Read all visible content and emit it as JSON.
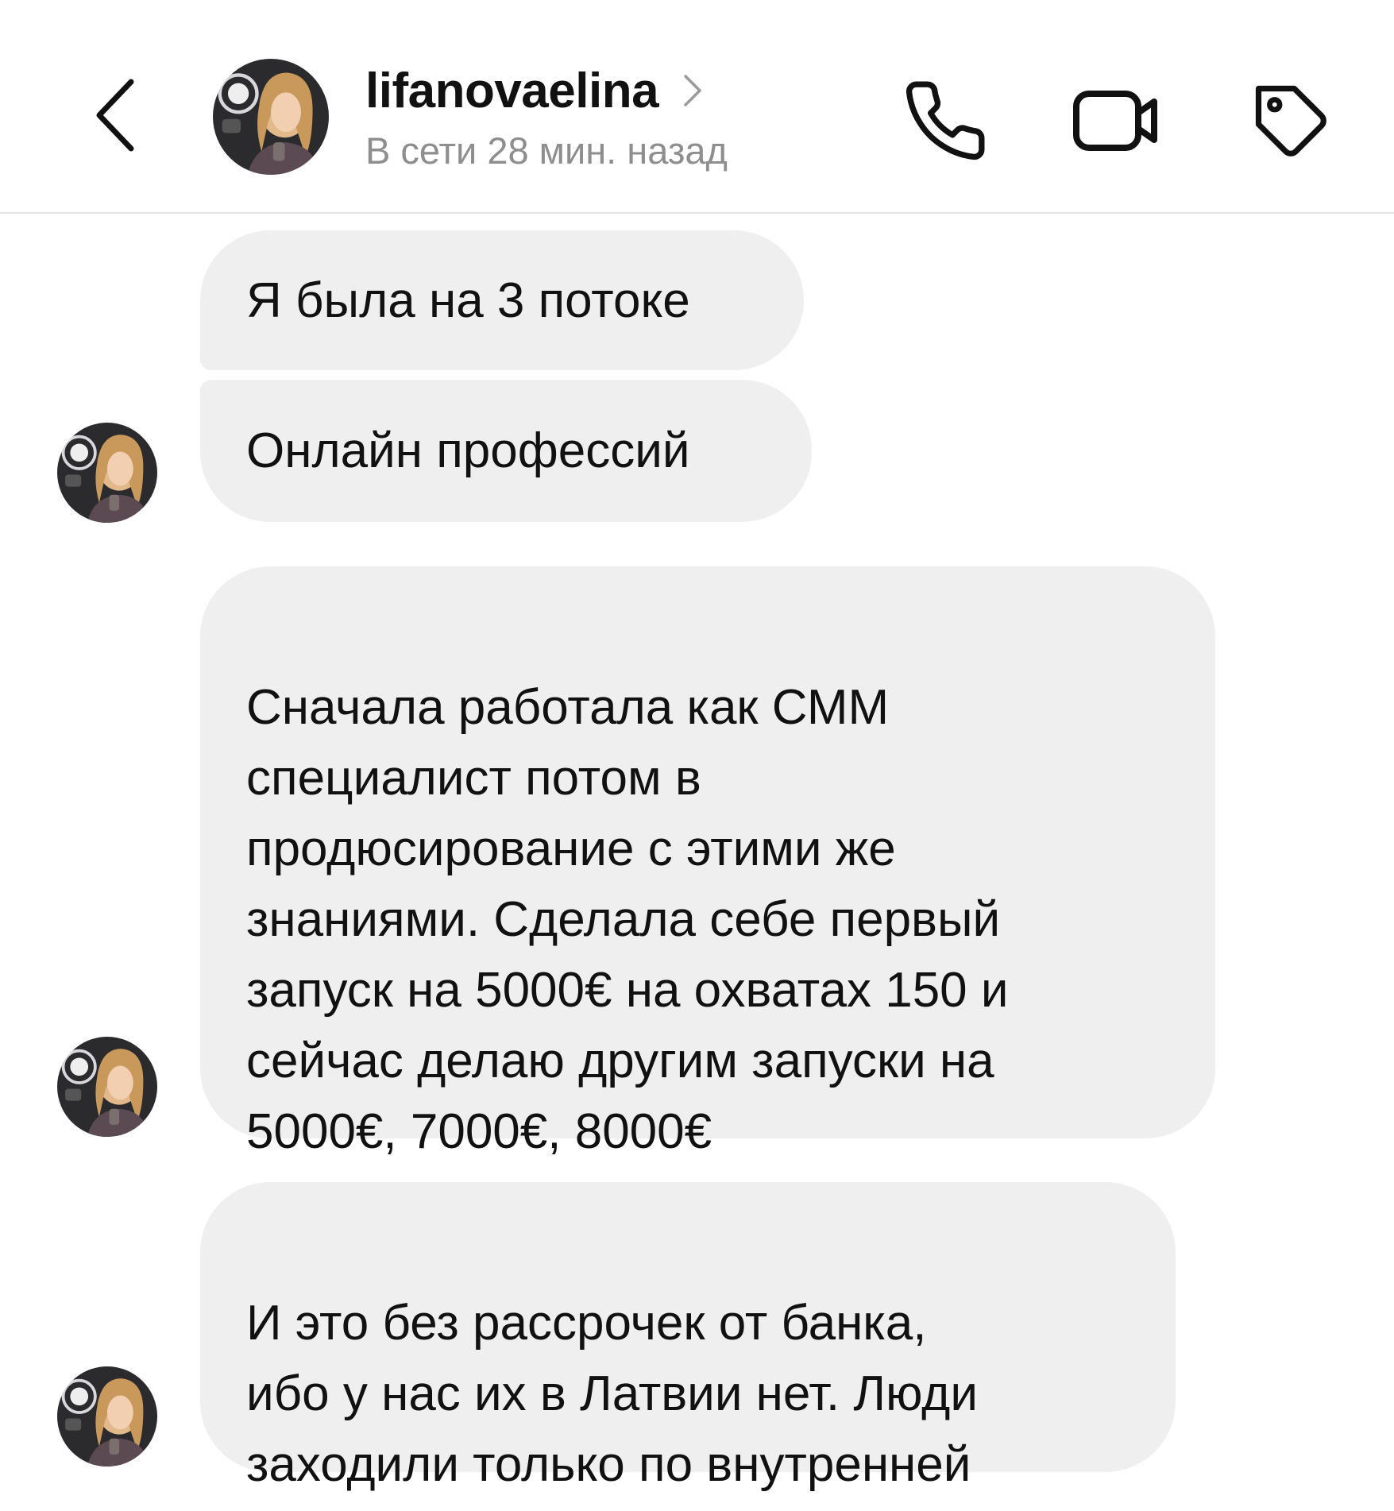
{
  "header": {
    "username": "lifanovaelina",
    "status": "В сети 28 мин. назад",
    "icons": {
      "back": "chevron-left-icon",
      "profile": "chevron-right-icon",
      "call": "phone-icon",
      "video": "video-camera-icon",
      "tag": "tag-icon"
    }
  },
  "messages": [
    {
      "text": "Я была на 3 потоке"
    },
    {
      "text": "Онлайн профессий"
    },
    {
      "text": "Сначала работала как СММ\nспециалист потом в\nпродюсирование с этими же\nзнаниями. Сделала себе первый\nзапуск на 5000€ на охватах 150 и\nсейчас делаю другим запуски на\n5000€, 7000€, 8000€"
    },
    {
      "text": "И это без рассрочек от банка,\nибо у нас их в Латвии нет. Люди\nзаходили только по внутренней"
    }
  ],
  "colors": {
    "bubble": "#efefef",
    "text": "#111111",
    "muted": "#8e8e8e",
    "divider": "#e3e3e3"
  }
}
